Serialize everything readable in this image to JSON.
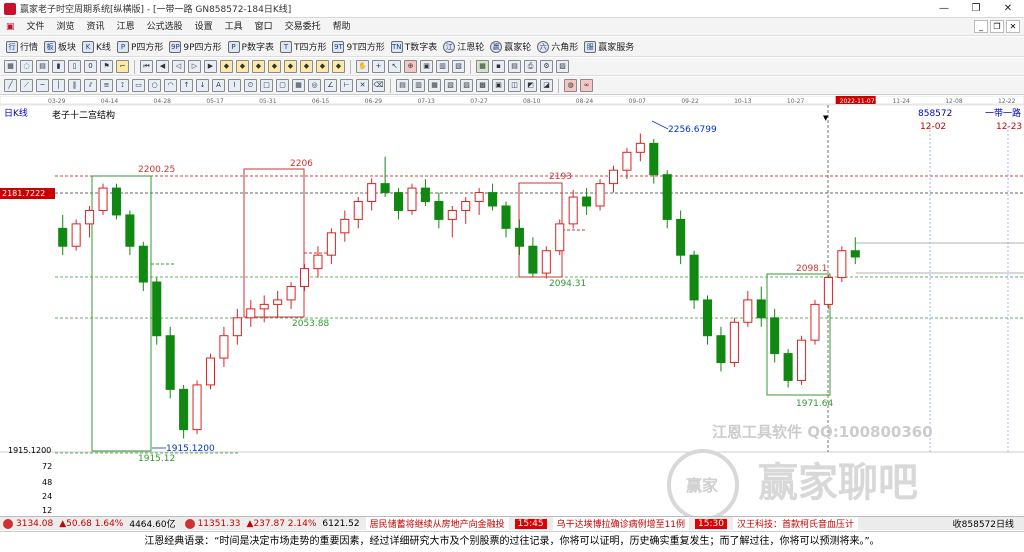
{
  "window": {
    "title": "赢家老子时空周期系统[纵横版] - [一带一路  GN858572-184日K线]",
    "controls": [
      "—",
      "❐",
      "✕"
    ]
  },
  "menu": {
    "items": [
      "文件",
      "浏览",
      "资讯",
      "江恩",
      "公式选股",
      "设置",
      "工具",
      "窗口",
      "交易委托",
      "帮助"
    ]
  },
  "toolbar": {
    "items": [
      {
        "icon": "行",
        "label": "行情"
      },
      {
        "icon": "板",
        "label": "板块"
      },
      {
        "icon": "K",
        "label": "K线"
      },
      {
        "icon": "P",
        "label": "P四方形"
      },
      {
        "icon": "9P",
        "label": "9P四方形"
      },
      {
        "icon": "P",
        "label": "P数字表"
      },
      {
        "icon": "T",
        "label": "T四方形"
      },
      {
        "icon": "9T",
        "label": "9T四方形"
      },
      {
        "icon": "TN",
        "label": "T数字表"
      },
      {
        "icon": "江",
        "label": "江恩轮"
      },
      {
        "icon": "赢",
        "label": "赢家轮"
      },
      {
        "icon": "六",
        "label": "六角形"
      },
      {
        "icon": "服",
        "label": "赢家服务"
      }
    ]
  },
  "chart": {
    "period_label": "日K线",
    "indicator_title": "老子十二宫结构",
    "symbol": "858572",
    "symbol_name": "一带一路",
    "date_marker": "2022-11-07",
    "dates": [
      "03-29",
      "04-14",
      "04-28",
      "05-17",
      "05-31",
      "06-15",
      "06-29",
      "07-13",
      "07-27",
      "08-10",
      "08-24",
      "09-07",
      "09-22",
      "10-13",
      "10-27",
      "2022-11-07",
      "11-24",
      "12-08",
      "12-22"
    ],
    "future_dates": [
      "12-02",
      "12-23"
    ],
    "price_labels": {
      "current": "2181.7222",
      "low_axis": "1915.1200"
    },
    "volume_axis": [
      "72",
      "48",
      "24",
      "12"
    ],
    "annotations": [
      "2256.6799",
      "2200.25",
      "2206",
      "2193",
      "2098.1",
      "2094.31",
      "2053.88",
      "1971.64",
      "1915.1200",
      "1915.12"
    ],
    "watermark": [
      "江恩工具软件  QQ:100800360",
      "赢家聊吧",
      "赢家"
    ]
  },
  "chart_data": {
    "type": "candlestick",
    "title": "老子十二宫结构",
    "xlabel": "",
    "ylabel": "",
    "ylim": [
      1900,
      2270
    ],
    "ohlc": [
      [
        2150,
        2165,
        2120,
        2130
      ],
      [
        2130,
        2160,
        2125,
        2155
      ],
      [
        2155,
        2175,
        2140,
        2170
      ],
      [
        2170,
        2200,
        2165,
        2195
      ],
      [
        2195,
        2200,
        2160,
        2165
      ],
      [
        2165,
        2170,
        2120,
        2130
      ],
      [
        2130,
        2135,
        2080,
        2090
      ],
      [
        2090,
        2095,
        2020,
        2030
      ],
      [
        2030,
        2040,
        1960,
        1970
      ],
      [
        1970,
        1975,
        1915,
        1925
      ],
      [
        1925,
        1980,
        1920,
        1975
      ],
      [
        1975,
        2010,
        1970,
        2005
      ],
      [
        2005,
        2040,
        1995,
        2030
      ],
      [
        2030,
        2060,
        2020,
        2050
      ],
      [
        2050,
        2070,
        2040,
        2060
      ],
      [
        2060,
        2075,
        2045,
        2065
      ],
      [
        2065,
        2080,
        2050,
        2070
      ],
      [
        2070,
        2090,
        2060,
        2085
      ],
      [
        2085,
        2110,
        2080,
        2105
      ],
      [
        2105,
        2130,
        2095,
        2120
      ],
      [
        2120,
        2150,
        2110,
        2145
      ],
      [
        2145,
        2170,
        2135,
        2160
      ],
      [
        2160,
        2185,
        2150,
        2180
      ],
      [
        2180,
        2206,
        2170,
        2200
      ],
      [
        2200,
        2230,
        2185,
        2190
      ],
      [
        2190,
        2195,
        2160,
        2170
      ],
      [
        2170,
        2200,
        2165,
        2195
      ],
      [
        2195,
        2205,
        2175,
        2180
      ],
      [
        2180,
        2190,
        2150,
        2160
      ],
      [
        2160,
        2175,
        2140,
        2170
      ],
      [
        2170,
        2185,
        2155,
        2180
      ],
      [
        2180,
        2195,
        2165,
        2190
      ],
      [
        2190,
        2200,
        2170,
        2175
      ],
      [
        2175,
        2180,
        2140,
        2150
      ],
      [
        2150,
        2160,
        2120,
        2130
      ],
      [
        2130,
        2140,
        2095,
        2100
      ],
      [
        2100,
        2130,
        2094,
        2125
      ],
      [
        2125,
        2160,
        2120,
        2155
      ],
      [
        2155,
        2193,
        2150,
        2185
      ],
      [
        2185,
        2195,
        2165,
        2175
      ],
      [
        2175,
        2205,
        2170,
        2200
      ],
      [
        2200,
        2220,
        2190,
        2215
      ],
      [
        2215,
        2240,
        2205,
        2235
      ],
      [
        2235,
        2256,
        2225,
        2245
      ],
      [
        2245,
        2250,
        2200,
        2210
      ],
      [
        2210,
        2215,
        2150,
        2160
      ],
      [
        2160,
        2170,
        2110,
        2120
      ],
      [
        2120,
        2125,
        2060,
        2070
      ],
      [
        2070,
        2075,
        2020,
        2030
      ],
      [
        2030,
        2040,
        1990,
        2000
      ],
      [
        2000,
        2050,
        1995,
        2045
      ],
      [
        2045,
        2080,
        2040,
        2070
      ],
      [
        2070,
        2085,
        2040,
        2050
      ],
      [
        2050,
        2060,
        2000,
        2010
      ],
      [
        2010,
        2015,
        1972,
        1980
      ],
      [
        1980,
        2030,
        1975,
        2025
      ],
      [
        2025,
        2070,
        2020,
        2065
      ],
      [
        2065,
        2098,
        2060,
        2095
      ],
      [
        2095,
        2130,
        2090,
        2125
      ],
      [
        2125,
        2140,
        2110,
        2118
      ]
    ]
  },
  "statusbar": {
    "idx1": "3134.08",
    "idx1_chg": "▲50.68 1.64%",
    "idx1_amt": "4464.60亿",
    "idx2": "11351.33",
    "idx2_chg": "▲237.87 2.14%",
    "idx2_amt": "6121.52",
    "news1": "居民储蓄将继续从房地产向金融投",
    "t1": "15:45",
    "news2": "乌干达埃博拉确诊病例增至11例",
    "t2": "15:30",
    "news3": "汉王科技：首款柯氏音血压计",
    "right": "收858572日线"
  },
  "quote": {
    "text": "江恩经典语录：“时间是决定市场走势的重要因素，经过详细研究大市及个别股票的过往记录，你将可以证明，历史确实重复发生；而了解过往，你将可以预测将来。”。"
  }
}
